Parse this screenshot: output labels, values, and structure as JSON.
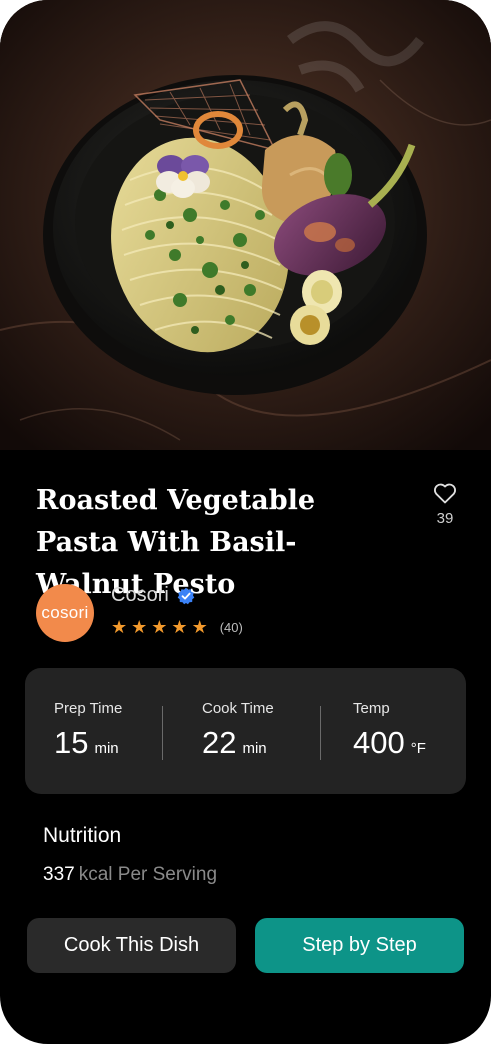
{
  "recipe": {
    "title": "Roasted Vegetable Pasta With Basil-Walnut Pesto",
    "favorites_count": "39",
    "hero_icon": "pasta-photo"
  },
  "author": {
    "avatar_text": "cosori",
    "name": "Cosori",
    "verified_icon": "verified-badge-icon",
    "rating_stars": 5,
    "rating_count": "(40)"
  },
  "stats": [
    {
      "label": "Prep Time",
      "value": "15",
      "unit": "min"
    },
    {
      "label": "Cook Time",
      "value": "22",
      "unit": "min"
    },
    {
      "label": "Temp",
      "value": "400",
      "unit": "°F"
    }
  ],
  "nutrition": {
    "title": "Nutrition",
    "kcal": "337",
    "kcal_text": "kcal Per Serving"
  },
  "actions": {
    "cook_label": "Cook This Dish",
    "step_label": "Step by Step"
  },
  "colors": {
    "background": "#000000",
    "card": "#232323",
    "accent": "#0d9488",
    "avatar": "#f28a4b",
    "star": "#f39a2d"
  }
}
